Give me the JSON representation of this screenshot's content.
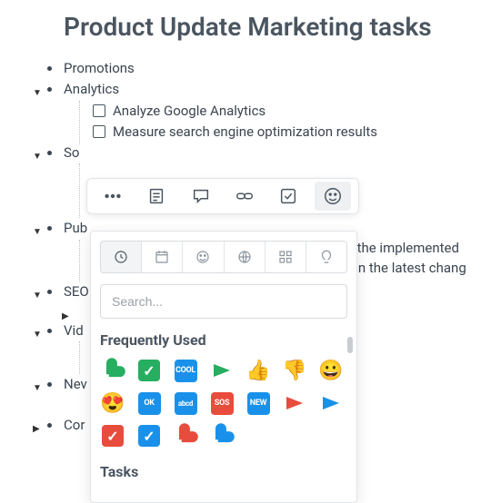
{
  "title": "Product Update Marketing tasks",
  "outline": {
    "promotions": "Promotions",
    "analytics": "Analytics",
    "analyze": "Analyze Google Analytics",
    "measure": "Measure search engine optimization results",
    "social": "So",
    "public": "Pub",
    "pub_frag1": "for the implemented",
    "pub_frag2": "plain the latest chang",
    "seo": "SEO",
    "video": "Vid",
    "news": "Nev",
    "contact": "Cor"
  },
  "toolbar": {
    "icons": [
      "more",
      "note",
      "comment",
      "link",
      "task",
      "emoji"
    ]
  },
  "picker": {
    "categories": [
      "recent",
      "calendar",
      "smiley",
      "sports",
      "symbols",
      "idea"
    ],
    "search_placeholder": "Search...",
    "frequently_used": "Frequently Used",
    "tasks": "Tasks",
    "emoji_labels": {
      "cool": "COOL",
      "ok": "OK",
      "abcd": "abcd",
      "sos": "SOS",
      "new": "NEW"
    }
  }
}
